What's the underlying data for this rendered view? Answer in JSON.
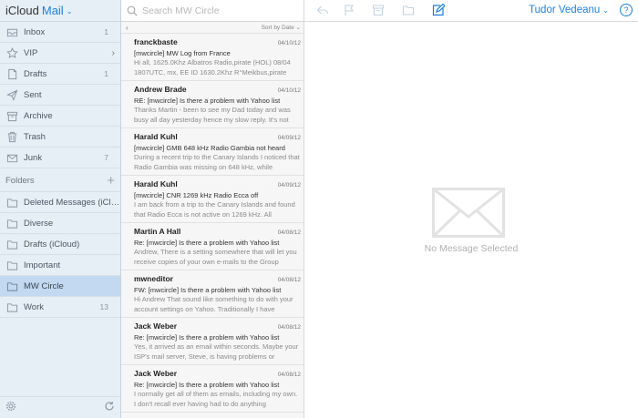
{
  "sidebar": {
    "brand": "iCloud",
    "app": "Mail",
    "mailboxes": [
      {
        "label": "Inbox",
        "count": "1",
        "icon": "inbox-icon"
      },
      {
        "label": "VIP",
        "count": "",
        "icon": "star-icon"
      },
      {
        "label": "Drafts",
        "count": "1",
        "icon": "drafts-icon"
      },
      {
        "label": "Sent",
        "count": "",
        "icon": "sent-icon"
      },
      {
        "label": "Archive",
        "count": "",
        "icon": "archive-icon"
      },
      {
        "label": "Trash",
        "count": "",
        "icon": "trash-icon"
      },
      {
        "label": "Junk",
        "count": "7",
        "icon": "junk-icon"
      }
    ],
    "folders_label": "Folders",
    "folders": [
      {
        "label": "Deleted Messages (iCloud)",
        "count": ""
      },
      {
        "label": "Diverse",
        "count": ""
      },
      {
        "label": "Drafts (iCloud)",
        "count": ""
      },
      {
        "label": "Important",
        "count": ""
      },
      {
        "label": "MW Circle",
        "count": "",
        "selected": true
      },
      {
        "label": "Work",
        "count": "13"
      }
    ]
  },
  "search": {
    "placeholder": "Search MW Circle",
    "value": ""
  },
  "sort_label": "Sort by Date",
  "messages": [
    {
      "from": "franckbaste",
      "date": "04/10/12",
      "subject": "[mwcircle] MW Log from France",
      "preview": "Hi all, 1625.0Khz Albatros Radio,pirate (HOL) 08/04 1807UTC, mx, EE ID 1630.2Khz R°Meikbus,pirate"
    },
    {
      "from": "Andrew Brade",
      "date": "04/10/12",
      "subject": "RE: [mwcircle] Is there a problem with Yahoo list",
      "preview": "Thanks Martin - been to see my Dad today and was busy all day yesterday hence my slow reply. It's not"
    },
    {
      "from": "Harald Kuhl",
      "date": "04/09/12",
      "subject": "[mwcircle] GMB 648 kHz Radio Gambia not heard",
      "preview": "During a recent trip to the Canary Islands I noticed that Radio Gambia was missing on 648 kHz, while"
    },
    {
      "from": "Harald Kuhl",
      "date": "04/09/12",
      "subject": "[mwcircle] CNR 1269 kHz Radio Ecca off",
      "preview": "I am back from a trip to the Canary Islands and found that Radio Ecca is not active on 1269 kHz. All"
    },
    {
      "from": "Martin A Hall",
      "date": "04/08/12",
      "subject": "Re: [mwcircle] Is there a problem with Yahoo list",
      "preview": "Andrew, There is a setting somewhere that will let you receive copies of your own e-mails to the Group"
    },
    {
      "from": "mwneditor",
      "date": "04/08/12",
      "subject": "FW: [mwcircle] Is there a problem with Yahoo list",
      "preview": "Hi Andrew That sound like something to do with your account settings on Yahoo. Traditionally I have"
    },
    {
      "from": "Jack Weber",
      "date": "04/08/12",
      "subject": "Re: [mwcircle] Is there a problem with Yahoo list",
      "preview": "Yes, it arrived as an email within seconds. Maybe your ISP's mail server, Steve, is having problems or"
    },
    {
      "from": "Jack Weber",
      "date": "04/08/12",
      "subject": "Re: [mwcircle] Is there a problem with Yahoo list",
      "preview": "I normally get all of them as emails, including my own. I don't recall ever having had to do anything"
    }
  ],
  "user": {
    "name": "Tudor Vedeanu"
  },
  "help_label": "?",
  "empty_state": "No Message Selected",
  "colors": {
    "accent": "#1a82e2",
    "sidebar_bg": "#e6eef6",
    "selected_bg": "#c2d9f1"
  }
}
